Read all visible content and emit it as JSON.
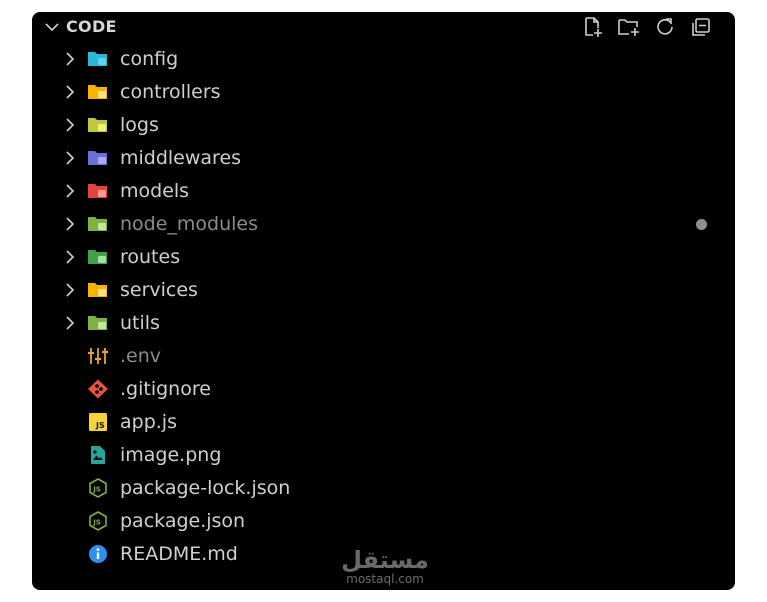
{
  "explorer": {
    "title": "CODE",
    "actions": [
      {
        "name": "new-file-icon"
      },
      {
        "name": "new-folder-icon"
      },
      {
        "name": "refresh-icon"
      },
      {
        "name": "collapse-all-icon"
      }
    ]
  },
  "items": [
    {
      "label": "config",
      "type": "folder",
      "icon": "folder-config-icon",
      "color": "#29b6d8",
      "badge": "#5fd3f0"
    },
    {
      "label": "controllers",
      "type": "folder",
      "icon": "folder-controllers-icon",
      "color": "#f5b400",
      "badge": "#ffe27a"
    },
    {
      "label": "logs",
      "type": "folder",
      "icon": "folder-logs-icon",
      "color": "#c0c73a",
      "badge": "#eef27d"
    },
    {
      "label": "middlewares",
      "type": "folder",
      "icon": "folder-middlewares-icon",
      "color": "#6b6fd6",
      "badge": "#a9acf5"
    },
    {
      "label": "models",
      "type": "folder",
      "icon": "folder-models-icon",
      "color": "#e0443d",
      "badge": "#ff9b95"
    },
    {
      "label": "node_modules",
      "type": "folder",
      "icon": "folder-node-icon",
      "color": "#7cb342",
      "badge": "#c5e79a",
      "dim": true,
      "modified": true
    },
    {
      "label": "routes",
      "type": "folder",
      "icon": "folder-routes-icon",
      "color": "#43a047",
      "badge": "#a5e0a8"
    },
    {
      "label": "services",
      "type": "folder",
      "icon": "folder-services-icon",
      "color": "#f5b400",
      "badge": "#ffe27a"
    },
    {
      "label": "utils",
      "type": "folder",
      "icon": "folder-utils-icon",
      "color": "#7cb342",
      "badge": "#c5e79a"
    },
    {
      "label": ".env",
      "type": "file",
      "icon": "env-settings-icon",
      "color": "#e6a23c",
      "dim": true
    },
    {
      "label": ".gitignore",
      "type": "file",
      "icon": "git-icon",
      "color": "#e2553b"
    },
    {
      "label": "app.js",
      "type": "file",
      "icon": "javascript-icon",
      "color": "#f7d23a"
    },
    {
      "label": "image.png",
      "type": "file",
      "icon": "image-file-icon",
      "color": "#26a69a"
    },
    {
      "label": "package-lock.json",
      "type": "file",
      "icon": "nodejs-icon",
      "color": "#7cb342"
    },
    {
      "label": "package.json",
      "type": "file",
      "icon": "nodejs-icon",
      "color": "#7cb342"
    },
    {
      "label": "README.md",
      "type": "file",
      "icon": "info-icon",
      "color": "#2f8ff0"
    }
  ],
  "watermark": {
    "arabic": "مستقل",
    "latin": "mostaql.com"
  }
}
